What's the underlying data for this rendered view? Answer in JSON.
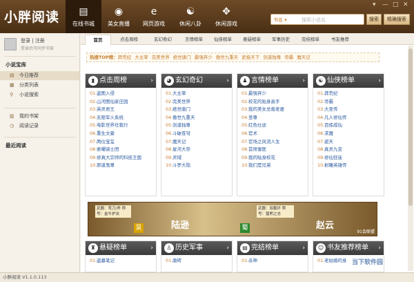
{
  "app": {
    "logo": "小胖阅读",
    "version": "小胖阅读 V1.1.0.113"
  },
  "nav": [
    {
      "label": "在线书城",
      "icon": "book-icon",
      "glyph": "▤",
      "active": true
    },
    {
      "label": "美女直播",
      "icon": "camera-icon",
      "glyph": "◉",
      "active": false
    },
    {
      "label": "网页游戏",
      "icon": "ie-icon",
      "glyph": "e",
      "active": false
    },
    {
      "label": "休闲八卦",
      "icon": "yinyang-icon",
      "glyph": "☯",
      "active": false
    },
    {
      "label": "休闲游戏",
      "icon": "gamepad-icon",
      "glyph": "✥",
      "active": false
    }
  ],
  "search": {
    "category": "书名 ▾",
    "placeholder": "搜索小说名",
    "button": "搜索",
    "precise": "精确搜索"
  },
  "window": {
    "controls": [
      "▾",
      "—",
      "□",
      "✕"
    ]
  },
  "user": {
    "login": "登录 | 注册",
    "sub": "登录后可同步书架"
  },
  "sidebar": {
    "section1": "小说宝库",
    "items1": [
      {
        "label": "今日推荐",
        "icon": "list-icon",
        "glyph": "▤",
        "active": true
      },
      {
        "label": "分类列表",
        "icon": "grid-icon",
        "glyph": "▦",
        "active": false
      },
      {
        "label": "小说搜索",
        "icon": "search-icon",
        "glyph": "⚲",
        "active": false
      }
    ],
    "items2": [
      {
        "label": "我的书架",
        "icon": "shelf-icon",
        "glyph": "▥"
      },
      {
        "label": "阅读记录",
        "icon": "clock-icon",
        "glyph": "◷"
      }
    ],
    "section2": "最近阅读"
  },
  "tabs": [
    "首页",
    "点击周榜",
    "玄幻奇幻",
    "言情榜单",
    "仙侠榜单",
    "悬疑榜单",
    "军事历史",
    "完结榜单",
    "书友推荐"
  ],
  "hot": {
    "label": "热搜TOP榜：",
    "keywords": [
      "莽荒纪",
      "大主宰",
      "完美世界",
      "绝世唐门",
      "最强弃少",
      "傲世九重天",
      "武极天下",
      "剑道独尊",
      "帝霸",
      "魔天记"
    ]
  },
  "panels_top": [
    {
      "title": "点击周榜",
      "icon": "c1-icon",
      "glyph": "▮",
      "items": [
        "盗图入侵",
        "山河图仙家庄园",
        "英灵君王",
        "无限军火系统",
        "电影世界任我行",
        "重生文豪",
        "两仪宝玺",
        "索曜骑士团",
        "修真大宗师的科技王国",
        "邪道鬼尊"
      ]
    },
    {
      "title": "玄幻奇幻",
      "icon": "c2-icon",
      "glyph": "◕",
      "items": [
        "大主宰",
        "完美世界",
        "绝世唐门",
        "傲世九重天",
        "剑道独尊",
        "斗破苍穹",
        "魔天记",
        "星河大帝",
        "灵域",
        "斗罗大陆"
      ]
    },
    {
      "title": "言情榜单",
      "icon": "c3-icon",
      "glyph": "♟",
      "items": [
        "最强弃少",
        "校花的贴身高手",
        "我的美女总裁老婆",
        "至尊",
        "红色仕途",
        "官术",
        "官场之风流人生",
        "首席御医",
        "我的贴身校花",
        "我们是兄弟"
      ]
    },
    {
      "title": "仙侠榜单",
      "icon": "c4-icon",
      "glyph": "☯",
      "items": [
        "莽荒纪",
        "帝霸",
        "大圣传",
        "凡人修仙传",
        "百炼成仙",
        "求魔",
        "遮天",
        "真灵九变",
        "修仙狂徒",
        "射雕英雄传"
      ]
    }
  ],
  "banner": {
    "left_badge": "武器：弯刀/斧 称号：金牛护法",
    "name_left": "吴",
    "name_mid": "陆逊",
    "name_right_tag": "蜀",
    "right_badge": "武器：双截环 称号：猛熊之志",
    "name_right": "赵云",
    "corner": "91会联盟"
  },
  "panels_bottom": [
    {
      "title": "悬疑榜单",
      "icon": "c5-icon",
      "glyph": "♜",
      "items": [
        "盗墓笔记"
      ]
    },
    {
      "title": "历史军事",
      "icon": "c6-icon",
      "glyph": "♙",
      "items": [
        "唐砖"
      ]
    },
    {
      "title": "完结榜单",
      "icon": "c7-icon",
      "glyph": "▤",
      "items": [
        "杀神"
      ]
    },
    {
      "title": "书友推荐榜单",
      "icon": "c8-icon",
      "glyph": "☺",
      "items": [
        "老姑婚的身"
      ]
    }
  ],
  "watermark": "当下软件园"
}
